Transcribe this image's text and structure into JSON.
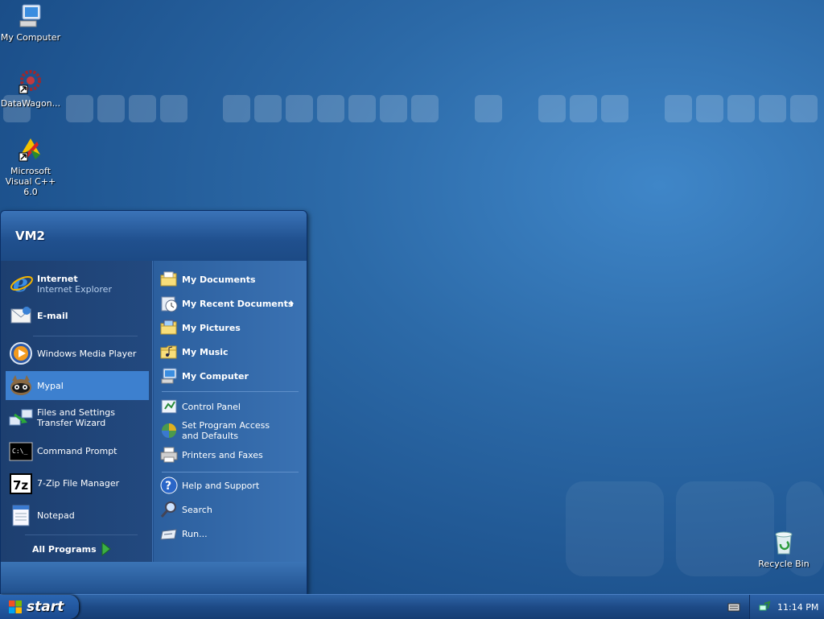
{
  "desktop": {
    "icons": [
      {
        "label": "My Computer"
      },
      {
        "label": "DataWagon..."
      },
      {
        "label": "Microsoft Visual C++ 6.0"
      },
      {
        "label": "Recycle Bin"
      }
    ]
  },
  "start_menu": {
    "user": "VM2",
    "pinned": [
      {
        "title": "Internet",
        "subtitle": "Internet Explorer",
        "icon": "internet-explorer-icon"
      },
      {
        "title": "E-mail",
        "icon": "email-icon"
      }
    ],
    "recent": [
      {
        "label": "Windows Media Player",
        "icon": "media-player-icon"
      },
      {
        "label": "Mypal",
        "icon": "mypal-icon",
        "selected": true
      },
      {
        "label": "Files and Settings Transfer Wizard",
        "icon": "transfer-wizard-icon"
      },
      {
        "label": "Command Prompt",
        "icon": "command-prompt-icon"
      },
      {
        "label": "7-Zip File Manager",
        "icon": "7zip-icon"
      },
      {
        "label": "Notepad",
        "icon": "notepad-icon"
      }
    ],
    "all_programs": "All Programs",
    "places": [
      {
        "label": "My Documents",
        "icon": "folder-icon"
      },
      {
        "label": "My Recent Documents",
        "icon": "recent-documents-icon"
      },
      {
        "label": "My Pictures",
        "icon": "pictures-folder-icon"
      },
      {
        "label": "My Music",
        "icon": "music-folder-icon"
      },
      {
        "label": "My Computer",
        "icon": "computer-icon"
      }
    ],
    "system": [
      {
        "label": "Control Panel",
        "icon": "control-panel-icon"
      },
      {
        "label": "Set Program Access and Defaults",
        "icon": "program-defaults-icon"
      },
      {
        "label": "Printers and Faxes",
        "icon": "printer-icon"
      }
    ],
    "tools": [
      {
        "label": "Help and Support",
        "icon": "help-icon"
      },
      {
        "label": "Search",
        "icon": "search-icon"
      },
      {
        "label": "Run...",
        "icon": "run-icon"
      }
    ]
  },
  "taskbar": {
    "start_label": "start",
    "clock": "11:14 PM"
  },
  "colors": {
    "selected_item": "#3d80cf",
    "taskbar": "#1d4a86"
  }
}
